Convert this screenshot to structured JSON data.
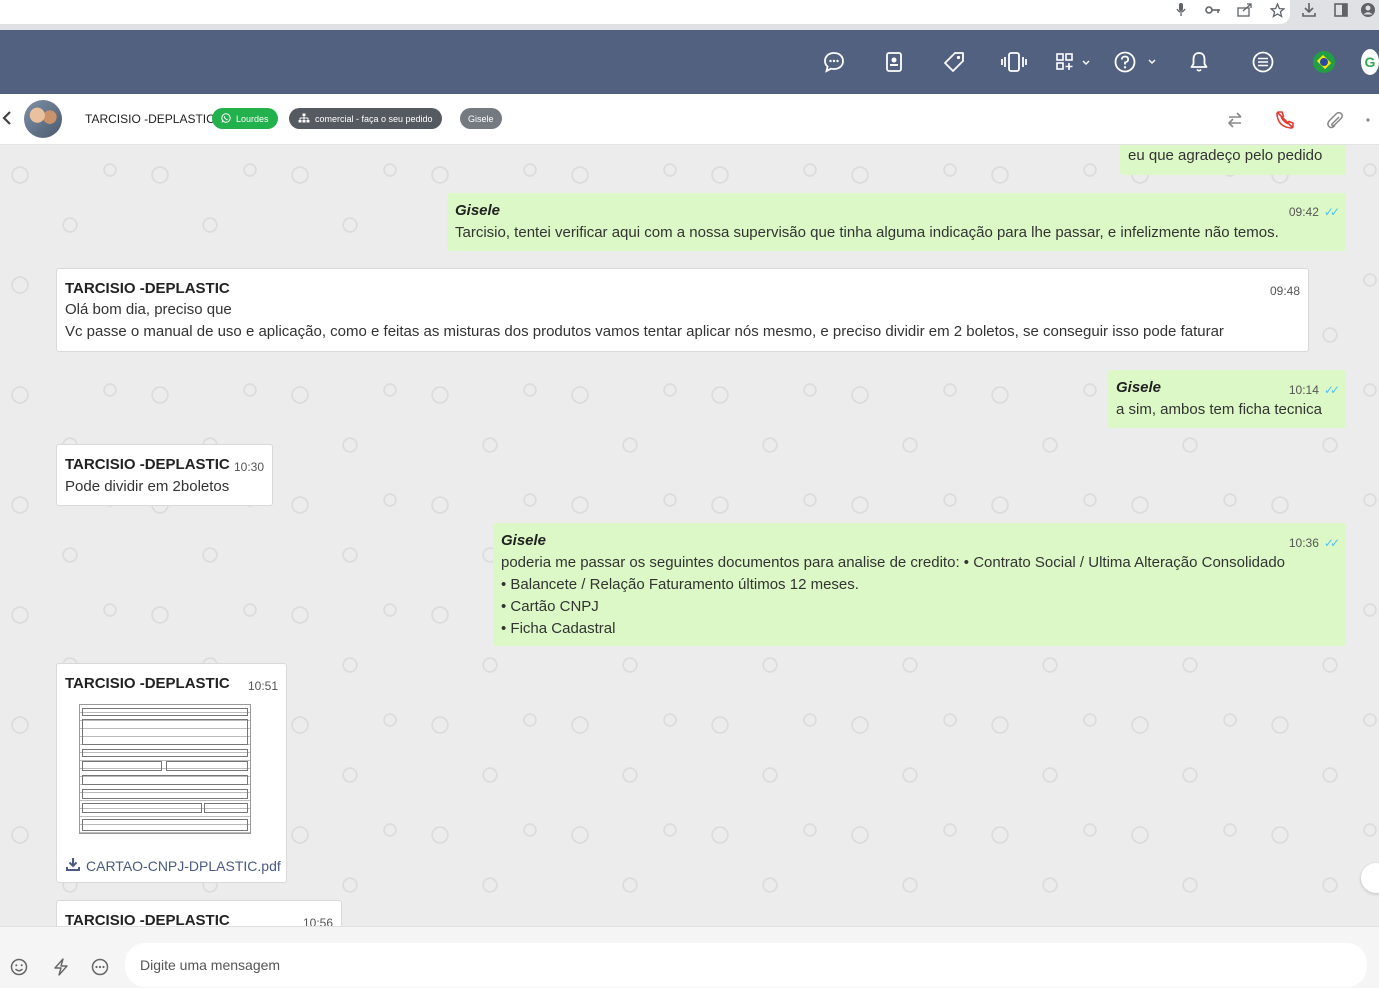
{
  "app": {
    "contact_name": "TARCISIO -DEPLASTIC",
    "tags": {
      "whatsapp": "Lourdes",
      "queue": "comercial - faça o seu pedido",
      "user": "Gisele"
    }
  },
  "messages": [
    {
      "id": "m0",
      "direction": "out",
      "sender": "",
      "time": "",
      "lines": [
        "eu que agradeço pelo pedido"
      ]
    },
    {
      "id": "m1",
      "direction": "out",
      "sender": "Gisele",
      "time": "09:42",
      "lines": [
        "Tarcisio, tentei verificar aqui com a nossa supervisão que tinha alguma indicação para lhe passar, e infelizmente não temos."
      ]
    },
    {
      "id": "m2",
      "direction": "in",
      "sender": "TARCISIO -DEPLASTIC",
      "time": "09:48",
      "lines": [
        "Olá bom dia, preciso que",
        "Vc passe o manual de uso e aplicação, como e feitas as misturas dos produtos vamos tentar aplicar nós mesmo, e preciso dividir em 2 boletos, se conseguir isso pode faturar"
      ]
    },
    {
      "id": "m3",
      "direction": "out",
      "sender": "Gisele",
      "time": "10:14",
      "lines": [
        "a sim, ambos tem ficha tecnica"
      ]
    },
    {
      "id": "m4",
      "direction": "in",
      "sender": "TARCISIO -DEPLASTIC",
      "time": "10:30",
      "lines": [
        "Pode dividir em 2boletos"
      ]
    },
    {
      "id": "m5",
      "direction": "out",
      "sender": "Gisele",
      "time": "10:36",
      "lines": [
        "poderia me passar os seguintes documentos para analise de credito: • Contrato Social / Ultima Alteração Consolidado",
        "• Balancete / Relação Faturamento últimos 12 meses.",
        "• Cartão CNPJ",
        "• Ficha Cadastral"
      ]
    },
    {
      "id": "m6",
      "direction": "in",
      "sender": "TARCISIO -DEPLASTIC",
      "time": "10:51",
      "file": "CARTAO-CNPJ-DPLASTIC.pdf"
    },
    {
      "id": "m7",
      "direction": "in",
      "sender": "TARCISIO -DEPLASTIC",
      "time": "10:56"
    }
  ],
  "composer": {
    "placeholder": "Digite uma mensagem"
  },
  "colors": {
    "navbar": "#536180",
    "outgoing_bubble": "#dcf8c6",
    "incoming_bubble": "#ffffff",
    "chat_bg": "#ececec",
    "tag_green": "#22b14c"
  },
  "icons": {
    "navbar": [
      "chat-icon",
      "contacts-icon",
      "tag-icon",
      "vibrate-icon",
      "apps-icon",
      "help-icon",
      "bell-icon",
      "list-icon",
      "brazil-flag-icon",
      "google-avatar-icon"
    ],
    "header": [
      "back-icon",
      "transfer-icon",
      "end-call-icon",
      "attach-icon"
    ],
    "footer": [
      "emoji-icon",
      "quick-reply-icon",
      "more-icon"
    ]
  }
}
